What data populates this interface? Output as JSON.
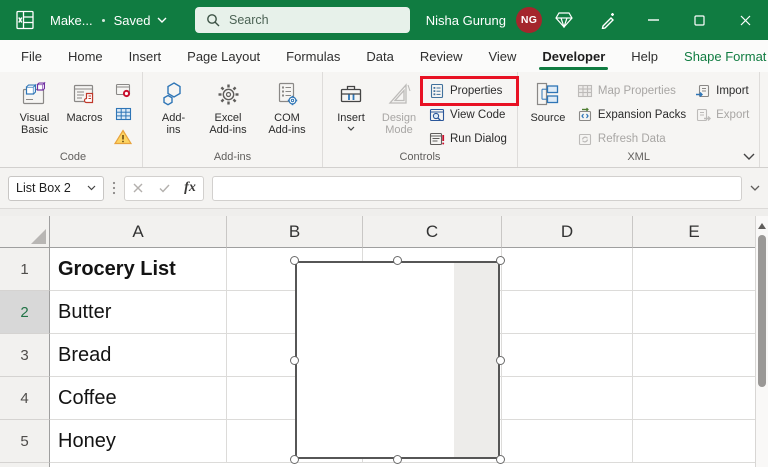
{
  "colors": {
    "excel_green": "#107C41",
    "highlight_red": "#E81123",
    "avatar_bg": "#A4262C"
  },
  "titlebar": {
    "doc_title": "Make...",
    "autosave_label": "Saved",
    "search_placeholder": "Search",
    "user_name": "Nisha Gurung",
    "user_initials": "NG"
  },
  "tabs": {
    "items": [
      "File",
      "Home",
      "Insert",
      "Page Layout",
      "Formulas",
      "Data",
      "Review",
      "View",
      "Developer",
      "Help",
      "Shape Format"
    ],
    "active": "Developer"
  },
  "ribbon": {
    "code": {
      "group_label": "Code",
      "visual_basic_line1": "Visual",
      "visual_basic_line2": "Basic",
      "macros": "Macros"
    },
    "addins": {
      "group_label": "Add-ins",
      "addins_line1": "Add-",
      "addins_line2": "ins",
      "excel_line1": "Excel",
      "excel_line2": "Add-ins",
      "com_line1": "COM",
      "com_line2": "Add-ins"
    },
    "controls": {
      "group_label": "Controls",
      "insert": "Insert",
      "design_line1": "Design",
      "design_line2": "Mode",
      "properties": "Properties",
      "view_code": "View Code",
      "run_dialog": "Run Dialog"
    },
    "xml": {
      "group_label": "XML",
      "source": "Source",
      "map_properties": "Map Properties",
      "expansion_packs": "Expansion Packs",
      "refresh_data": "Refresh Data",
      "import": "Import",
      "export": "Export"
    }
  },
  "formula_bar": {
    "name_box_value": "List Box 2",
    "fx_label": "fx",
    "formula_value": ""
  },
  "sheet": {
    "column_headers": [
      "A",
      "B",
      "C",
      "D",
      "E"
    ],
    "rows": [
      {
        "num": "1",
        "a": "Grocery List"
      },
      {
        "num": "2",
        "a": "Butter"
      },
      {
        "num": "3",
        "a": "Bread"
      },
      {
        "num": "4",
        "a": "Coffee"
      },
      {
        "num": "5",
        "a": "Honey"
      }
    ],
    "active_row_num": "2",
    "embedded_object": "List Box 2"
  }
}
